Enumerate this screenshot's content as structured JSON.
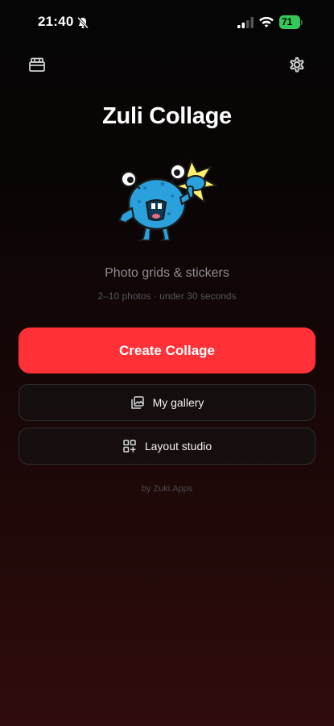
{
  "status_bar": {
    "time": "21:40",
    "battery": "71"
  },
  "header": {
    "left_icon": "gift-card-icon",
    "right_icon": "gear-icon"
  },
  "app": {
    "title": "Zuli Collage",
    "tagline": "Photo grids & stickers",
    "subtag": "2–10 photos · under 30 seconds",
    "footer": "by Zuki.Apps"
  },
  "actions": {
    "create_label": "Create Collage",
    "gallery_label": "My gallery",
    "gallery_icon": "gallery-icon",
    "layout_label": "Layout studio",
    "layout_icon": "layout-grid-icon"
  },
  "colors": {
    "primary": "#ff3136",
    "battery": "#34c759",
    "mascot": "#2aa0dc"
  }
}
